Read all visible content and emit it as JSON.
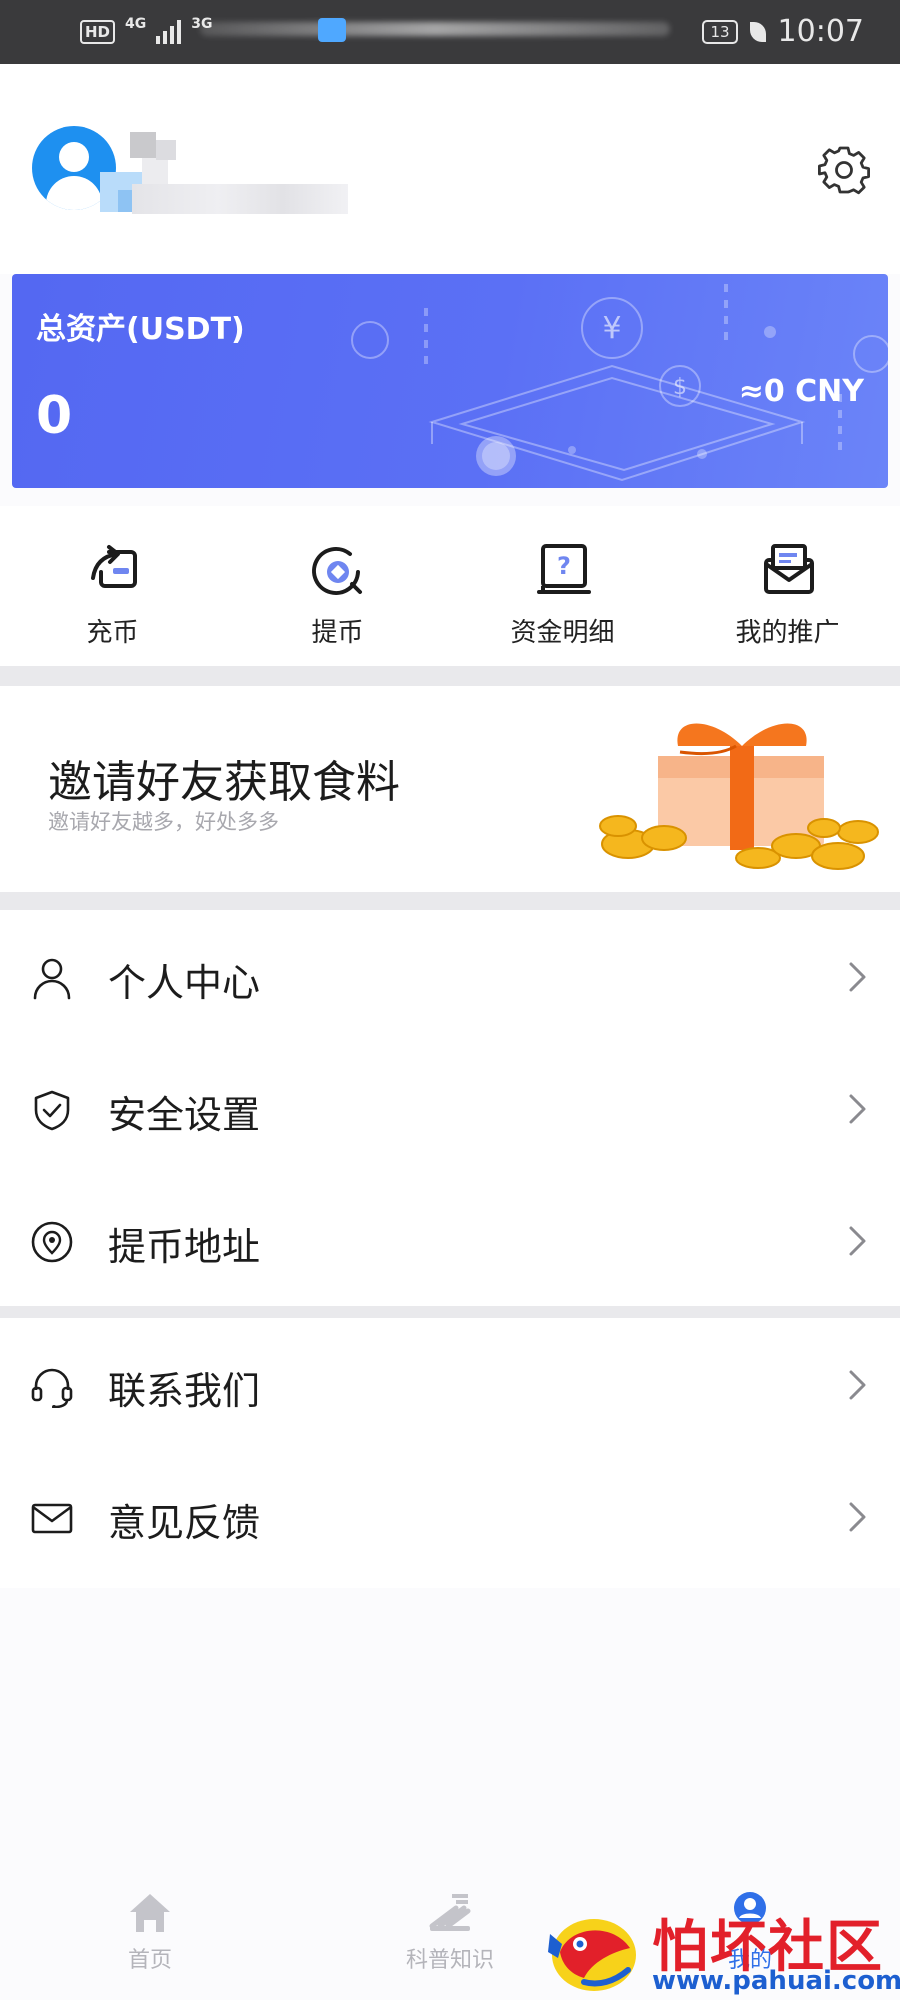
{
  "status_bar": {
    "hd": "HD",
    "network_4g": "4G",
    "network_3g": "3G",
    "battery": "13",
    "time": "10:07"
  },
  "profile": {
    "avatar_icon": "user-avatar-icon",
    "settings_icon": "gear-icon"
  },
  "asset_card": {
    "label": "总资产(USDT)",
    "value": "0",
    "cny": "≈0 CNY",
    "bg_color": "#5b70f5"
  },
  "actions": [
    {
      "label": "充币",
      "icon": "deposit-icon"
    },
    {
      "label": "提币",
      "icon": "withdraw-icon"
    },
    {
      "label": "资金明细",
      "icon": "fund-details-icon"
    },
    {
      "label": "我的推广",
      "icon": "promotion-icon"
    }
  ],
  "invite": {
    "title": "邀请好友获取食料",
    "subtitle": "邀请好友越多，好处多多"
  },
  "menu": {
    "group1": [
      {
        "label": "个人中心",
        "icon": "user-icon"
      },
      {
        "label": "安全设置",
        "icon": "shield-icon"
      },
      {
        "label": "提币地址",
        "icon": "location-icon"
      }
    ],
    "group2": [
      {
        "label": "联系我们",
        "icon": "headset-icon"
      },
      {
        "label": "意见反馈",
        "icon": "mail-icon"
      }
    ]
  },
  "bottom_nav": [
    {
      "label": "首页",
      "icon": "home-icon"
    },
    {
      "label": "科普知识",
      "icon": "knowledge-icon"
    },
    {
      "label": "我的",
      "icon": "profile-icon"
    }
  ],
  "watermark": {
    "title": "怕坏社区",
    "url": "www.pahuai.com"
  }
}
